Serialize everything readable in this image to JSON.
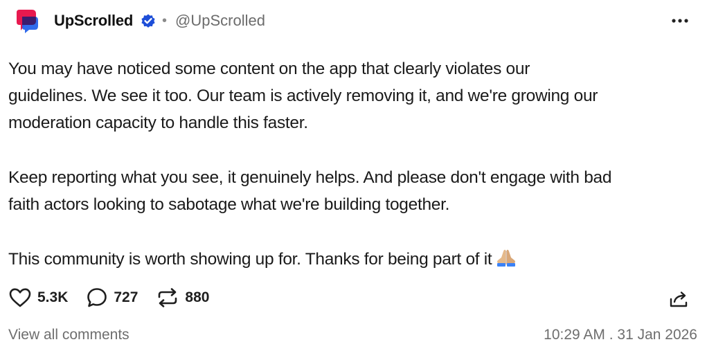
{
  "author": {
    "display_name": "UpScrolled",
    "separator": "•",
    "handle": "@UpScrolled",
    "verified": true,
    "avatar_icon": "upscrolled-logo-icon",
    "brand_colors": [
      "#e8194f",
      "#2563eb"
    ]
  },
  "header": {
    "more_icon": "more-dots-icon"
  },
  "post": {
    "paragraphs": [
      "You may have noticed some content on the app that clearly violates our\nguidelines. We see it too. Our team is actively removing it, and we're growing our\nmoderation capacity to handle this faster.",
      "Keep reporting what you see, it genuinely helps. And please don't engage with bad\nfaith actors looking to sabotage what we're building together.",
      "This community is worth showing up for. Thanks for being part of it"
    ],
    "trailing_emoji": "folded-hands-emoji"
  },
  "actions": {
    "likes": "5.3K",
    "comments": "727",
    "reposts": "880",
    "like_icon": "heart-icon",
    "comment_icon": "comment-bubble-icon",
    "repost_icon": "repost-icon",
    "share_icon": "share-icon"
  },
  "footer": {
    "view_comments": "View all comments",
    "timestamp": "10:29 AM . 31 Jan 2026"
  },
  "colors": {
    "text": "#1a1a1a",
    "muted": "#6e6e6e",
    "verified_badge": "#1d4ed8"
  }
}
